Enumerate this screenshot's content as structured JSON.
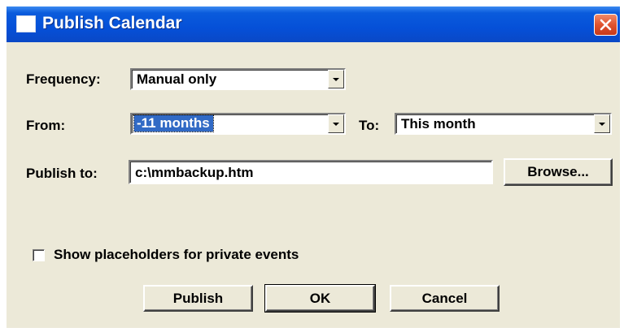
{
  "window": {
    "title": "Publish Calendar",
    "icon": "calendar-window-icon",
    "close_icon": "close-icon"
  },
  "form": {
    "frequency_label": "Frequency:",
    "frequency_value": "Manual only",
    "from_label": "From:",
    "from_value": "-11 months",
    "to_label": "To:",
    "to_value": "This month",
    "publish_to_label": "Publish to:",
    "publish_to_value": "c:\\mmbackup.htm",
    "browse_label": "Browse...",
    "placeholders_label": "Show placeholders for private events",
    "placeholders_checked": false
  },
  "buttons": {
    "publish_label": "Publish",
    "ok_label": "OK",
    "cancel_label": "Cancel"
  },
  "colors": {
    "titlebar": "#0550d8",
    "face": "#ece9d8",
    "selection": "#316ac5",
    "close": "#e0532f"
  }
}
